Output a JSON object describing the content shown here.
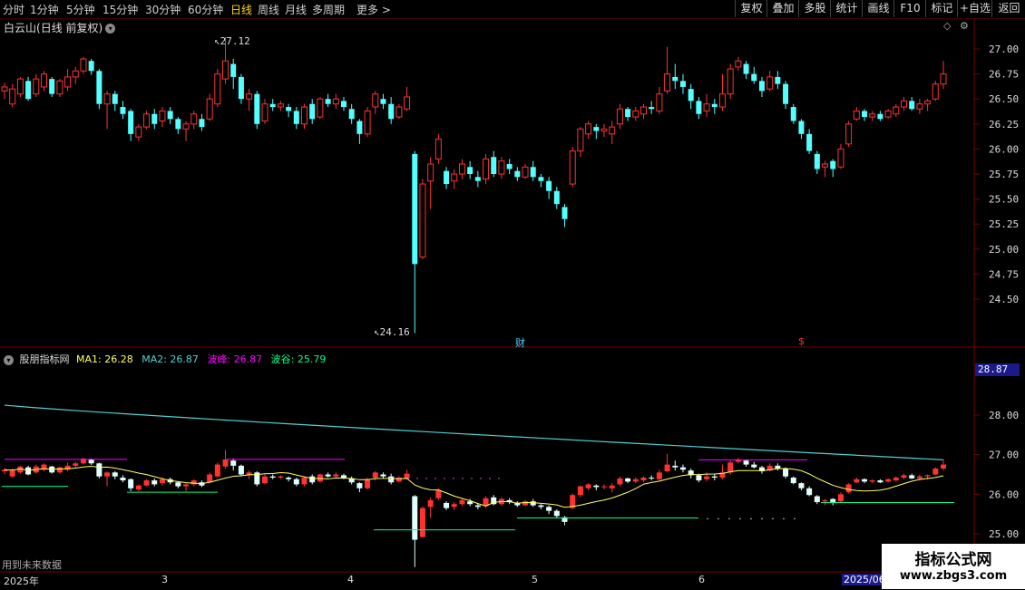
{
  "toolbar": {
    "timeframes": [
      {
        "label": "分时",
        "x": 3
      },
      {
        "label": "1分钟",
        "x": 33
      },
      {
        "label": "5分钟",
        "x": 73
      },
      {
        "label": "15分钟",
        "x": 113
      },
      {
        "label": "30分钟",
        "x": 160
      },
      {
        "label": "60分钟",
        "x": 207
      },
      {
        "label": "日线",
        "x": 254,
        "active": true
      },
      {
        "label": "周线",
        "x": 284
      },
      {
        "label": "月线",
        "x": 314
      },
      {
        "label": "多周期",
        "x": 344
      },
      {
        "label": "更多 >",
        "x": 393
      }
    ],
    "right_buttons": [
      "复权",
      "叠加",
      "多股",
      "统计",
      "画线",
      "F10",
      "标记",
      "+自选",
      "返回"
    ]
  },
  "stock": {
    "name": "白云山",
    "mode": "(日线 前复权)"
  },
  "main_chart": {
    "price_axis": [
      "27.00",
      "26.75",
      "26.50",
      "26.25",
      "26.00",
      "25.75",
      "25.50",
      "25.25",
      "25.00",
      "24.75",
      "24.50"
    ],
    "high_label": "27.12",
    "low_label": "24.16",
    "marker_cai": "财",
    "marker_s": "$"
  },
  "indicator": {
    "name": "股朋指标网",
    "ma1_label": "MA1: 26.28",
    "ma2_label": "MA2: 26.87",
    "peak_label": "波峰: 26.87",
    "valley_label": "波谷: 25.79",
    "axis": [
      "28.00",
      "27.00",
      "26.00",
      "25.00"
    ],
    "current_value": "28.87",
    "future_note": "用到未来数据"
  },
  "dates": {
    "year": "2025年",
    "m3": "3",
    "m4": "4",
    "m5": "5",
    "m6": "6",
    "current": "2025/06"
  },
  "watermark": {
    "line1": "指标公式网",
    "line2": "www.zbgs3.com"
  },
  "colors": {
    "up": "#ff3232",
    "down": "#54ffff",
    "ma1": "#ffff66",
    "ma2": "#4fd1d1",
    "peak": "#ff00ff",
    "valley": "#00ff88"
  },
  "chart_data": {
    "type": "candlestick",
    "ylim": [
      24.16,
      27.12
    ],
    "candles": [
      [
        26.58,
        26.62,
        26.5,
        26.66
      ],
      [
        26.45,
        26.6,
        26.42,
        26.65
      ],
      [
        26.55,
        26.7,
        26.52,
        26.72
      ],
      [
        26.68,
        26.5,
        26.48,
        26.72
      ],
      [
        26.55,
        26.7,
        26.52,
        26.75
      ],
      [
        26.62,
        26.75,
        26.58,
        26.78
      ],
      [
        26.7,
        26.55,
        26.52,
        26.72
      ],
      [
        26.55,
        26.68,
        26.52,
        26.7
      ],
      [
        26.62,
        26.72,
        26.58,
        26.8
      ],
      [
        26.72,
        26.78,
        26.65,
        26.82
      ],
      [
        26.78,
        26.9,
        26.75,
        26.92
      ],
      [
        26.88,
        26.78,
        26.74,
        26.9
      ],
      [
        26.78,
        26.45,
        26.4,
        26.8
      ],
      [
        26.45,
        26.55,
        26.2,
        26.58
      ],
      [
        26.55,
        26.45,
        26.38,
        26.58
      ],
      [
        26.42,
        26.35,
        26.3,
        26.48
      ],
      [
        26.38,
        26.15,
        26.08,
        26.4
      ],
      [
        26.12,
        26.22,
        26.08,
        26.25
      ],
      [
        26.22,
        26.35,
        26.2,
        26.38
      ],
      [
        26.35,
        26.25,
        26.2,
        26.4
      ],
      [
        26.28,
        26.38,
        26.22,
        26.42
      ],
      [
        26.38,
        26.3,
        26.25,
        26.42
      ],
      [
        26.3,
        26.2,
        26.15,
        26.32
      ],
      [
        26.2,
        26.25,
        26.08,
        26.28
      ],
      [
        26.25,
        26.35,
        26.2,
        26.38
      ],
      [
        26.3,
        26.22,
        26.18,
        26.35
      ],
      [
        26.3,
        26.5,
        26.28,
        26.55
      ],
      [
        26.45,
        26.75,
        26.42,
        26.8
      ],
      [
        26.7,
        26.88,
        26.65,
        27.12
      ],
      [
        26.85,
        26.72,
        26.6,
        26.9
      ],
      [
        26.72,
        26.5,
        26.45,
        26.75
      ],
      [
        26.5,
        26.55,
        26.38,
        26.6
      ],
      [
        26.55,
        26.25,
        26.2,
        26.58
      ],
      [
        26.28,
        26.45,
        26.25,
        26.5
      ],
      [
        26.45,
        26.42,
        26.38,
        26.5
      ],
      [
        26.42,
        26.45,
        26.38,
        26.48
      ],
      [
        26.42,
        26.38,
        26.32,
        26.45
      ],
      [
        26.38,
        26.25,
        26.2,
        26.42
      ],
      [
        26.25,
        26.42,
        26.2,
        26.45
      ],
      [
        26.45,
        26.3,
        26.25,
        26.5
      ],
      [
        26.32,
        26.5,
        26.3,
        26.52
      ],
      [
        26.5,
        26.45,
        26.42,
        26.55
      ],
      [
        26.45,
        26.5,
        26.4,
        26.55
      ],
      [
        26.48,
        26.42,
        26.38,
        26.52
      ],
      [
        26.4,
        26.3,
        26.25,
        26.45
      ],
      [
        26.28,
        26.15,
        26.05,
        26.3
      ],
      [
        26.15,
        26.38,
        26.12,
        26.42
      ],
      [
        26.42,
        26.55,
        26.35,
        26.58
      ],
      [
        26.5,
        26.45,
        26.4,
        26.55
      ],
      [
        26.45,
        26.3,
        26.25,
        26.52
      ],
      [
        26.32,
        26.42,
        26.3,
        26.45
      ],
      [
        26.4,
        26.52,
        26.38,
        26.62
      ],
      [
        25.95,
        24.85,
        24.16,
        25.98
      ],
      [
        24.92,
        25.65,
        24.9,
        25.7
      ],
      [
        25.68,
        25.85,
        25.4,
        25.92
      ],
      [
        25.9,
        26.1,
        25.85,
        26.15
      ],
      [
        25.78,
        25.65,
        25.6,
        25.82
      ],
      [
        25.68,
        25.75,
        25.6,
        25.8
      ],
      [
        25.75,
        25.85,
        25.7,
        25.9
      ],
      [
        25.82,
        25.75,
        25.7,
        25.88
      ],
      [
        25.72,
        25.68,
        25.62,
        25.78
      ],
      [
        25.7,
        25.9,
        25.65,
        25.95
      ],
      [
        25.92,
        25.75,
        25.72,
        25.98
      ],
      [
        25.75,
        25.88,
        25.7,
        25.92
      ],
      [
        25.85,
        25.8,
        25.75,
        25.9
      ],
      [
        25.78,
        25.72,
        25.68,
        25.82
      ],
      [
        25.72,
        25.82,
        25.7,
        25.85
      ],
      [
        25.82,
        25.72,
        25.68,
        25.88
      ],
      [
        25.72,
        25.68,
        25.62,
        25.75
      ],
      [
        25.68,
        25.58,
        25.5,
        25.72
      ],
      [
        25.58,
        25.45,
        25.4,
        25.62
      ],
      [
        25.42,
        25.3,
        25.22,
        25.45
      ],
      [
        25.65,
        25.98,
        25.62,
        26.02
      ],
      [
        25.98,
        26.2,
        25.92,
        26.22
      ],
      [
        26.15,
        26.25,
        26.1,
        26.28
      ],
      [
        26.22,
        26.18,
        26.1,
        26.25
      ],
      [
        26.18,
        26.2,
        26.12,
        26.25
      ],
      [
        26.15,
        26.22,
        26.05,
        26.28
      ],
      [
        26.25,
        26.4,
        26.2,
        26.45
      ],
      [
        26.4,
        26.32,
        26.28,
        26.42
      ],
      [
        26.32,
        26.38,
        26.28,
        26.42
      ],
      [
        26.35,
        26.42,
        26.3,
        26.45
      ],
      [
        26.42,
        26.4,
        26.35,
        26.48
      ],
      [
        26.38,
        26.55,
        26.35,
        26.62
      ],
      [
        26.58,
        26.75,
        26.55,
        27.02
      ],
      [
        26.72,
        26.68,
        26.6,
        26.85
      ],
      [
        26.68,
        26.62,
        26.55,
        26.75
      ],
      [
        26.6,
        26.48,
        26.4,
        26.65
      ],
      [
        26.48,
        26.35,
        26.3,
        26.52
      ],
      [
        26.38,
        26.45,
        26.32,
        26.55
      ],
      [
        26.45,
        26.42,
        26.35,
        26.5
      ],
      [
        26.42,
        26.55,
        26.38,
        26.75
      ],
      [
        26.55,
        26.8,
        26.5,
        26.85
      ],
      [
        26.82,
        26.88,
        26.78,
        26.92
      ],
      [
        26.85,
        26.75,
        26.7,
        26.88
      ],
      [
        26.75,
        26.68,
        26.65,
        26.82
      ],
      [
        26.68,
        26.58,
        26.52,
        26.72
      ],
      [
        26.6,
        26.72,
        26.58,
        26.78
      ],
      [
        26.72,
        26.65,
        26.6,
        26.78
      ],
      [
        26.65,
        26.45,
        26.4,
        26.68
      ],
      [
        26.42,
        26.28,
        26.25,
        26.45
      ],
      [
        26.28,
        26.15,
        26.1,
        26.3
      ],
      [
        26.15,
        25.98,
        25.95,
        26.2
      ],
      [
        25.95,
        25.8,
        25.75,
        25.98
      ],
      [
        25.82,
        25.85,
        25.72,
        25.88
      ],
      [
        25.88,
        25.8,
        25.72,
        25.9
      ],
      [
        25.82,
        26.0,
        25.8,
        26.05
      ],
      [
        26.05,
        26.25,
        26.02,
        26.28
      ],
      [
        26.3,
        26.38,
        26.28,
        26.42
      ],
      [
        26.38,
        26.32,
        26.28,
        26.4
      ],
      [
        26.32,
        26.35,
        26.28,
        26.38
      ],
      [
        26.35,
        26.3,
        26.28,
        26.38
      ],
      [
        26.32,
        26.38,
        26.3,
        26.4
      ],
      [
        26.35,
        26.42,
        26.32,
        26.45
      ],
      [
        26.42,
        26.48,
        26.38,
        26.52
      ],
      [
        26.48,
        26.4,
        26.38,
        26.52
      ],
      [
        26.4,
        26.45,
        26.35,
        26.5
      ],
      [
        26.45,
        26.48,
        26.38,
        26.5
      ],
      [
        26.5,
        26.65,
        26.48,
        26.68
      ],
      [
        26.65,
        26.75,
        26.6,
        26.88
      ]
    ]
  }
}
